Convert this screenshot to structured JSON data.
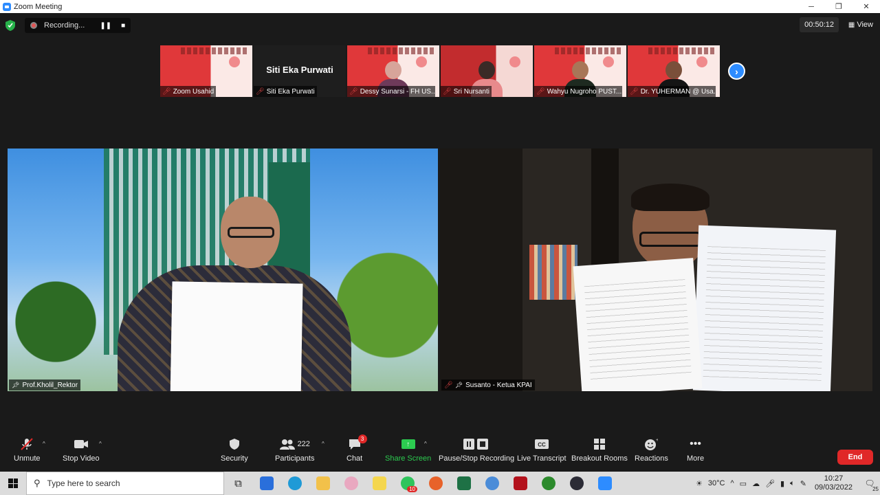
{
  "window": {
    "title": "Zoom Meeting",
    "minimize": "─",
    "restore": "❐",
    "close": "✕"
  },
  "topbar": {
    "recording_label": "Recording...",
    "pause_icon": "❚❚",
    "stop_icon": "■",
    "timer": "00:50:12",
    "view_label": "View"
  },
  "thumbnails": [
    {
      "name": "Zoom Usahid",
      "type": "slide"
    },
    {
      "name": "Siti Eka Purwati",
      "type": "name-only",
      "display_name": "Siti Eka Purwati"
    },
    {
      "name": "Dessy Sunarsi - FH US...",
      "type": "slide-person"
    },
    {
      "name": "Sri Nursanti",
      "type": "slide-person"
    },
    {
      "name": "Wahyu Nugroho PUST...",
      "type": "slide-person"
    },
    {
      "name": "Dr. YUHERMAN @ Usa...",
      "type": "slide-person"
    }
  ],
  "main_videos": [
    {
      "name": "Prof.Kholil_Rektor"
    },
    {
      "name": "Susanto - Ketua KPAI"
    }
  ],
  "toolbar": {
    "unmute": "Unmute",
    "stop_video": "Stop Video",
    "security": "Security",
    "participants": "Participants",
    "participants_count": "222",
    "chat": "Chat",
    "chat_badge": "3",
    "share_screen": "Share Screen",
    "pause_stop_recording": "Pause/Stop Recording",
    "live_transcript": "Live Transcript",
    "breakout_rooms": "Breakout Rooms",
    "reactions": "Reactions",
    "more": "More",
    "end": "End"
  },
  "taskbar": {
    "search_placeholder": "Type here to search",
    "whatsapp_badge": "10",
    "temperature": "30°C",
    "time": "10:27",
    "date": "09/03/2022",
    "notifications": "25"
  },
  "colors": {
    "accent": "#2d8cff",
    "end": "#e02828",
    "share": "#2ccc50"
  }
}
